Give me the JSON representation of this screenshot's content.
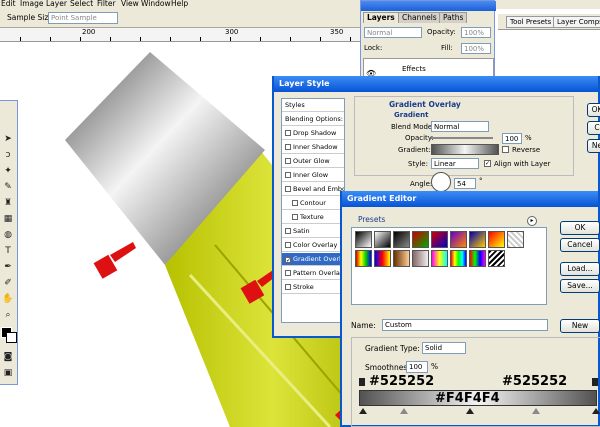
{
  "menu": [
    "Edit",
    "Image",
    "Layer",
    "Select",
    "Filter",
    "View",
    "Window",
    "Help"
  ],
  "options_bar": {
    "sample_size_label": "Sample Size:",
    "sample_size_value": "Point Sample"
  },
  "ruler": [
    "200",
    "300",
    "350"
  ],
  "tool_presets": {
    "tab1": "Tool Presets",
    "tab2": "Layer Comps"
  },
  "layers_panel": {
    "tabs": [
      "Layers",
      "Channels",
      "Paths"
    ],
    "blend_mode": "Normal",
    "opacity_label": "Opacity:",
    "opacity_value": "100%",
    "lock_label": "Lock:",
    "fill_label": "Fill:",
    "fill_value": "100%",
    "effects_label": "Effects"
  },
  "layer_style": {
    "title": "Layer Style",
    "list": [
      "Styles",
      "Blending Options: Default",
      "Drop Shadow",
      "Inner Shadow",
      "Outer Glow",
      "Inner Glow",
      "Bevel and Emboss",
      "Contour",
      "Texture",
      "Satin",
      "Color Overlay",
      "Gradient Overlay",
      "Pattern Overlay",
      "Stroke"
    ],
    "section": "Gradient Overlay",
    "subsection": "Gradient",
    "blend_mode_label": "Blend Mode:",
    "blend_mode_value": "Normal",
    "opacity_label": "Opacity:",
    "opacity_value": "100",
    "percent": "%",
    "gradient_label": "Gradient:",
    "reverse_label": "Reverse",
    "style_label": "Style:",
    "style_value": "Linear",
    "align_label": "Align with Layer",
    "angle_label": "Angle:",
    "angle_value": "54",
    "degree": "°",
    "right_buttons": [
      "OK",
      "C",
      "Ne"
    ]
  },
  "gradient_editor": {
    "title": "Gradient Editor",
    "presets_label": "Presets",
    "buttons": {
      "ok": "OK",
      "cancel": "Cancel",
      "load": "Load...",
      "save": "Save...",
      "new": "New"
    },
    "name_label": "Name:",
    "name_value": "Custom",
    "type_label": "Gradient Type:",
    "type_value": "Solid",
    "smoothness_label": "Smoothness:",
    "smoothness_value": "100",
    "percent": "%",
    "stop_left": "#525252",
    "stop_right": "#525252",
    "stop_mid": "#F4F4F4"
  },
  "colors": {
    "titlebar": "#0753d6",
    "selection": "#316ac5",
    "panel": "#ece9d8",
    "yellow": "#c8d41c",
    "hand": "#dd1111"
  }
}
